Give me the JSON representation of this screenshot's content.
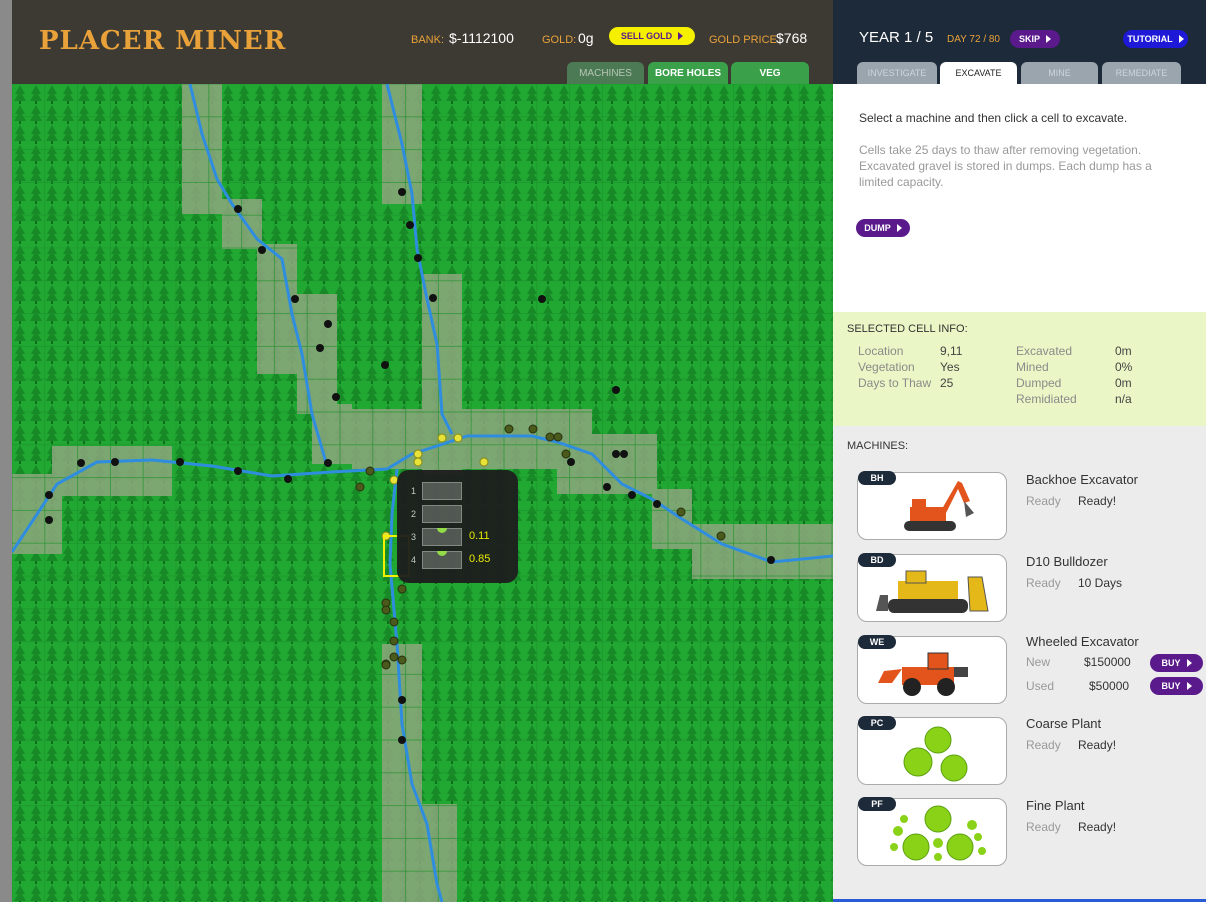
{
  "game": {
    "title": "PLACER MINER"
  },
  "header": {
    "bank_label": "BANK:",
    "bank_value": "$-1112100",
    "gold_label": "GOLD:",
    "gold_value": "0g",
    "sell_gold": "SELL GOLD",
    "gold_price_label": "GOLD PRICE:",
    "gold_price_value": "$768"
  },
  "map_tabs": [
    "MACHINES",
    "BORE HOLES",
    "VEG"
  ],
  "right_header": {
    "year": "YEAR 1 / 5",
    "day": "DAY 72 / 80",
    "skip": "SKIP",
    "tutorial": "TUTORIAL"
  },
  "phase_tabs": [
    "INVESTIGATE",
    "EXCAVATE",
    "MINE",
    "REMEDIATE"
  ],
  "instructions": {
    "main": "Select a machine and then click a cell to excavate.",
    "note": "Cells take 25 days to thaw after removing vegetation. Excavated gravel is stored in dumps. Each dump has a limited capacity.",
    "dump_button": "DUMP"
  },
  "cell_info": {
    "title": "SELECTED CELL INFO:",
    "left": [
      {
        "key": "Location",
        "value": "9,11"
      },
      {
        "key": "Vegetation",
        "value": "Yes"
      },
      {
        "key": "Days to Thaw",
        "value": "25"
      }
    ],
    "right": [
      {
        "key": "Excavated",
        "value": "0m"
      },
      {
        "key": "Mined",
        "value": "0%"
      },
      {
        "key": "Dumped",
        "value": "0m"
      },
      {
        "key": "Remidiated",
        "value": "n/a"
      }
    ]
  },
  "machines": {
    "title": "MACHINES:",
    "items": [
      {
        "code": "BH",
        "name": "Backhoe Excavator",
        "status_label": "Ready",
        "status_value": "Ready!"
      },
      {
        "code": "BD",
        "name": "D10 Bulldozer",
        "status_label": "Ready",
        "status_value": "10 Days"
      },
      {
        "code": "WE",
        "name": "Wheeled Excavator",
        "new_label": "New",
        "new_price": "$150000",
        "used_label": "Used",
        "used_price": "$50000",
        "buy": "BUY"
      },
      {
        "code": "PC",
        "name": "Coarse Plant",
        "status_label": "Ready",
        "status_value": "Ready!"
      },
      {
        "code": "PF",
        "name": "Fine Plant",
        "status_label": "Ready",
        "status_value": "Ready!"
      }
    ]
  },
  "popup": {
    "slots": [
      "1",
      "2",
      "3",
      "4"
    ],
    "values": [
      "",
      "",
      "0.11",
      "0.85"
    ]
  },
  "colors": {
    "accent_purple": "#5a1a8c",
    "gold": "#f5f000",
    "forest": "#1fa52e",
    "river": "#2f8de0",
    "header_dark": "#1d2a39"
  }
}
